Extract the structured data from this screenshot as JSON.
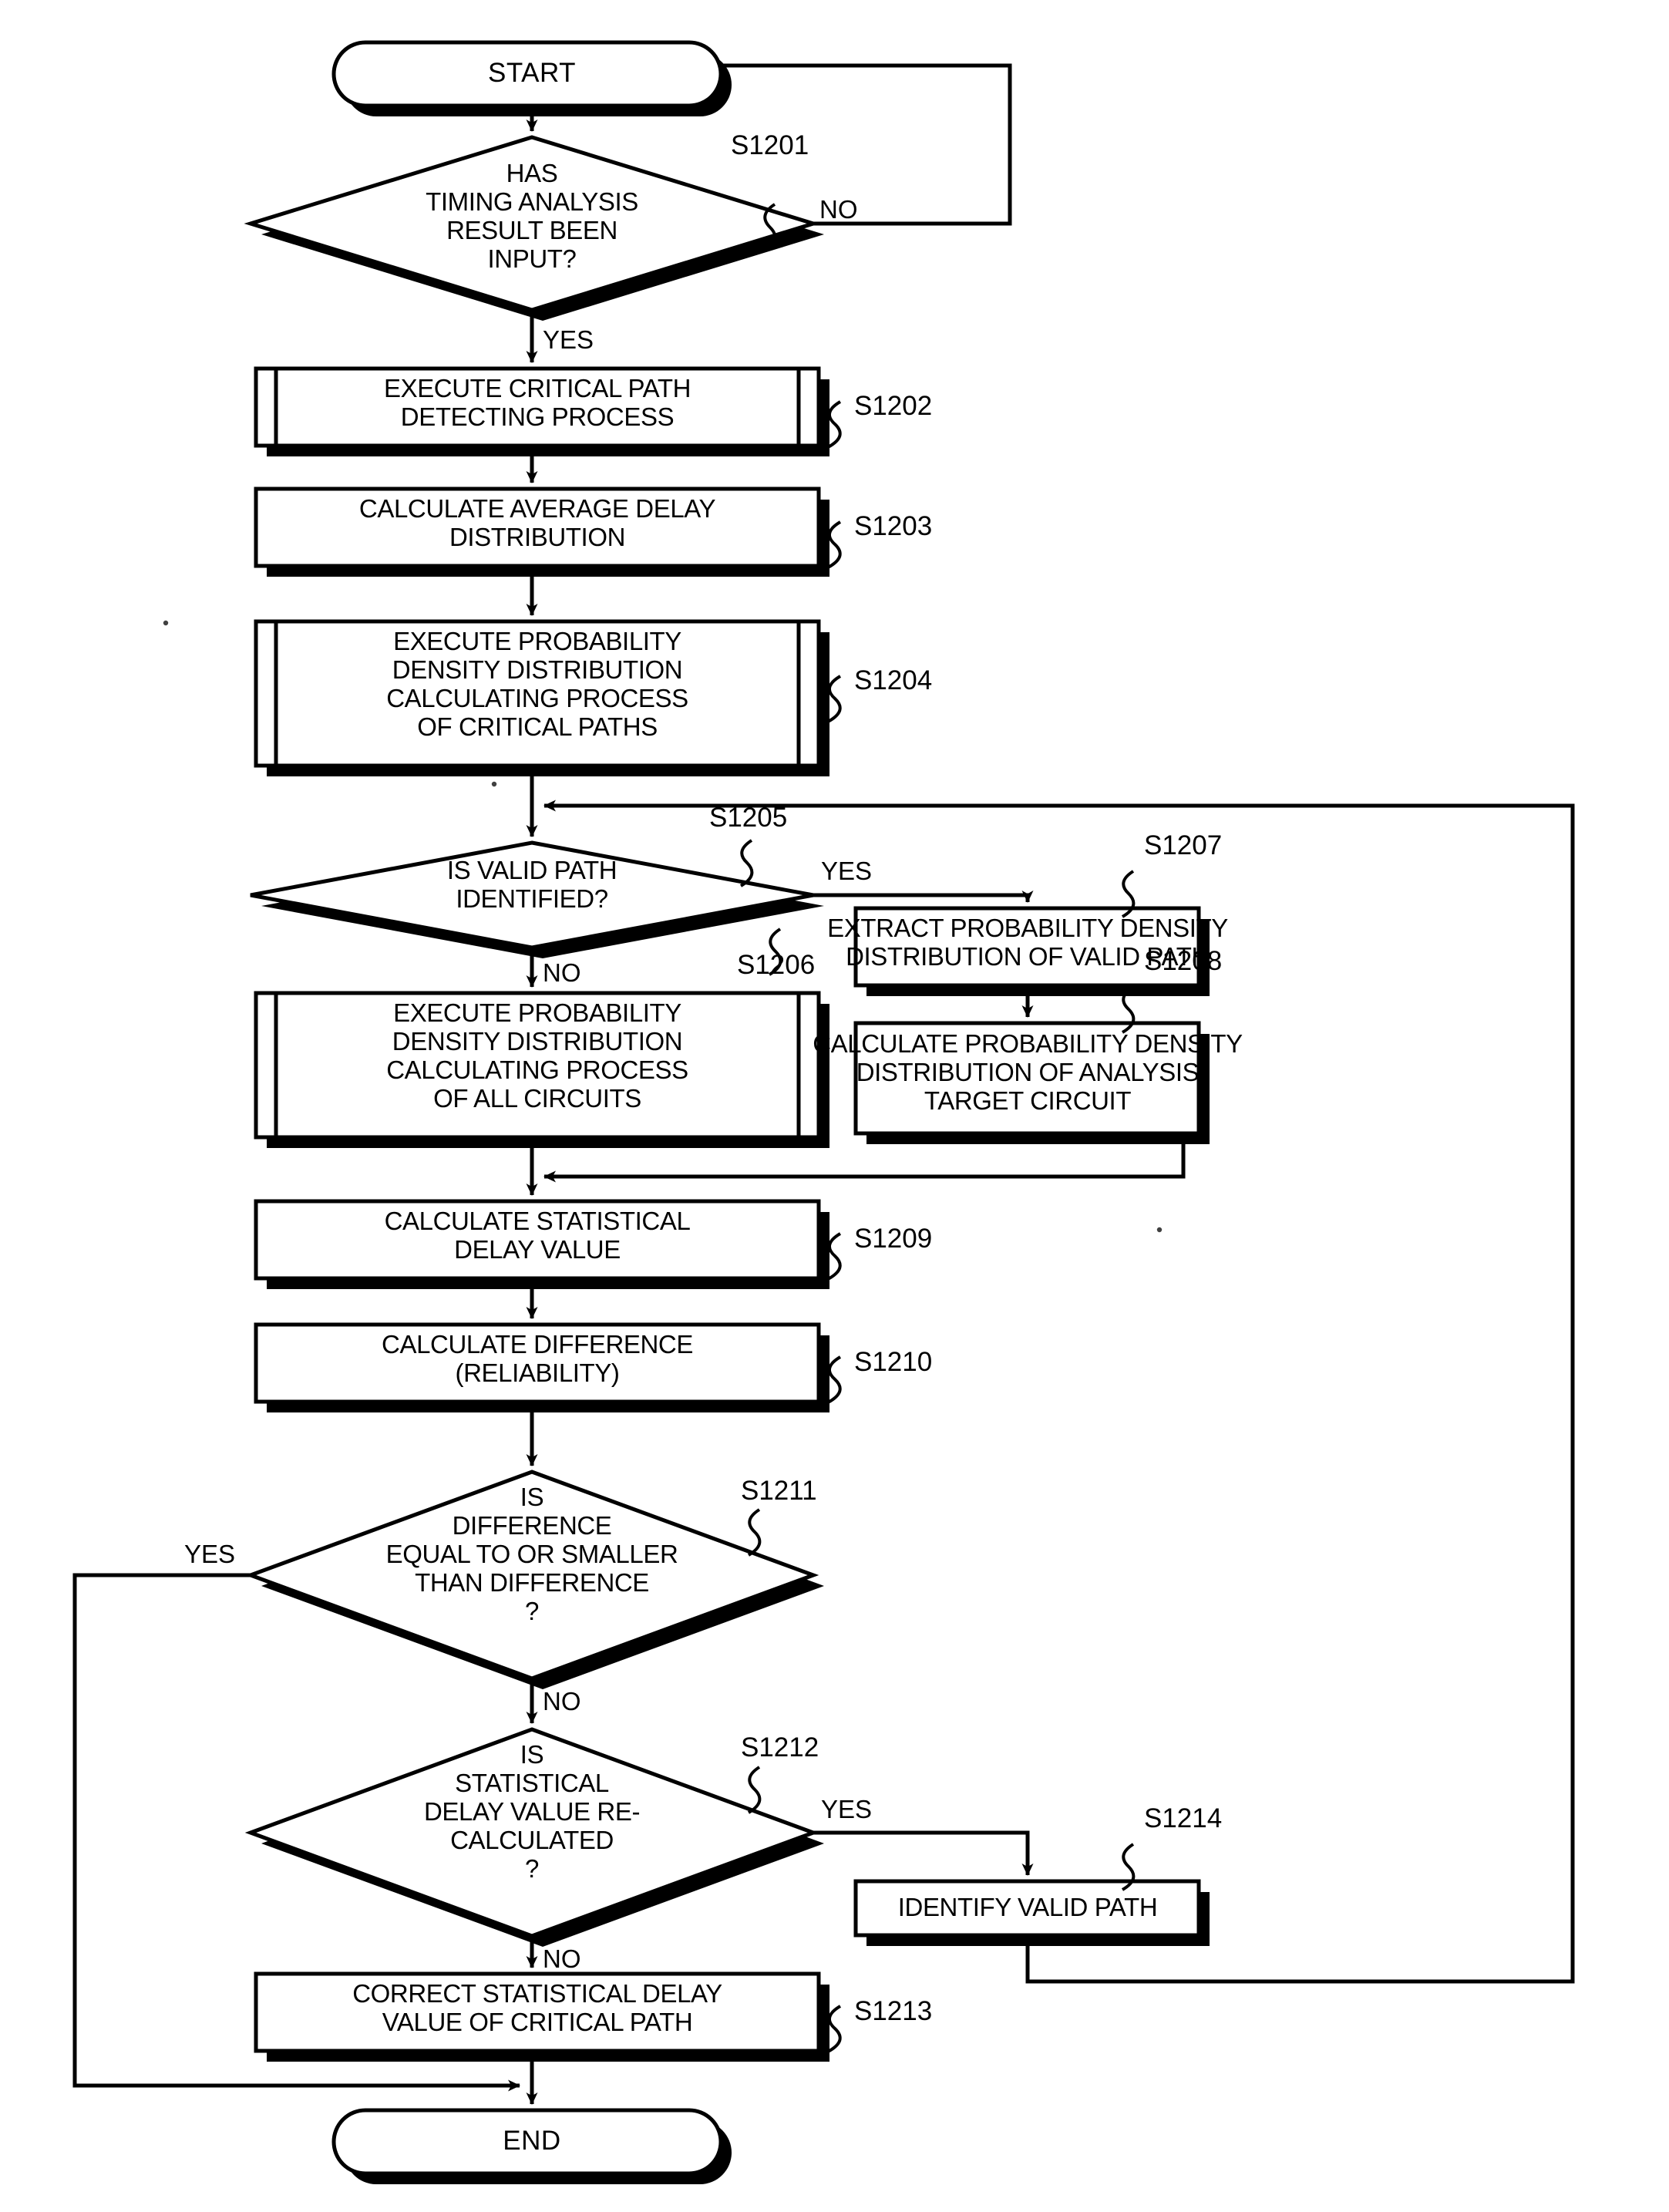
{
  "diagram": {
    "type": "flowchart",
    "title_text": "",
    "colors": {
      "stroke": "#000000",
      "fill": "#ffffff",
      "shadow": "#000000"
    },
    "terminators": [
      {
        "id": "start",
        "label": "START"
      },
      {
        "id": "end",
        "label": "END"
      }
    ],
    "decisions": [
      {
        "id": "d1201",
        "ref": "S1201",
        "lines": [
          "HAS",
          "TIMING ANALYSIS",
          "RESULT BEEN",
          "INPUT?"
        ],
        "yes": "YES",
        "no": "NO"
      },
      {
        "id": "d1205",
        "ref": "S1205",
        "lines": [
          "IS VALID PATH",
          "IDENTIFIED?"
        ],
        "yes": "YES",
        "no": "NO"
      },
      {
        "id": "d1211",
        "ref": "S1211",
        "lines": [
          "IS",
          "DIFFERENCE",
          "EQUAL TO OR SMALLER",
          "THAN DIFFERENCE",
          "?"
        ],
        "yes": "YES",
        "no": "NO"
      },
      {
        "id": "d1212",
        "ref": "S1212",
        "lines": [
          "IS",
          "STATISTICAL",
          "DELAY VALUE RE-",
          "CALCULATED",
          "?"
        ],
        "yes": "YES",
        "no": "NO"
      }
    ],
    "processes": [
      {
        "id": "p1202",
        "ref": "S1202",
        "kind": "predefined",
        "lines": [
          "EXECUTE CRITICAL PATH",
          "DETECTING PROCESS"
        ]
      },
      {
        "id": "p1203",
        "ref": "S1203",
        "kind": "process",
        "lines": [
          "CALCULATE AVERAGE DELAY",
          "DISTRIBUTION"
        ]
      },
      {
        "id": "p1204",
        "ref": "S1204",
        "kind": "predefined",
        "lines": [
          "EXECUTE PROBABILITY",
          "DENSITY DISTRIBUTION",
          "CALCULATING PROCESS",
          "OF CRITICAL PATHS"
        ]
      },
      {
        "id": "p1206",
        "ref": "S1206",
        "kind": "predefined",
        "lines": [
          "EXECUTE PROBABILITY",
          "DENSITY DISTRIBUTION",
          "CALCULATING PROCESS",
          "OF ALL CIRCUITS"
        ]
      },
      {
        "id": "p1207",
        "ref": "S1207",
        "kind": "process",
        "lines": [
          "EXTRACT PROBABILITY DENSITY",
          "DISTRIBUTION OF VALID PATH"
        ]
      },
      {
        "id": "p1208",
        "ref": "S1208",
        "kind": "process",
        "lines": [
          "CALCULATE PROBABILITY DENSITY",
          "DISTRIBUTION OF ANALYSIS",
          "TARGET CIRCUIT"
        ]
      },
      {
        "id": "p1209",
        "ref": "S1209",
        "kind": "process",
        "lines": [
          "CALCULATE STATISTICAL",
          "DELAY VALUE"
        ]
      },
      {
        "id": "p1210",
        "ref": "S1210",
        "kind": "process",
        "lines": [
          "CALCULATE DIFFERENCE",
          "(RELIABILITY)"
        ]
      },
      {
        "id": "p1213",
        "ref": "S1213",
        "kind": "process",
        "lines": [
          "CORRECT STATISTICAL DELAY",
          "VALUE OF CRITICAL PATH"
        ]
      },
      {
        "id": "p1214",
        "ref": "S1214",
        "kind": "process",
        "lines": [
          "IDENTIFY VALID PATH"
        ]
      }
    ]
  },
  "text": {
    "start": "START",
    "end": "END",
    "d1201_l1": "HAS",
    "d1201_l2": "TIMING ANALYSIS",
    "d1201_l3": "RESULT BEEN",
    "d1201_l4": "INPUT?",
    "d1201_ref": "S1201",
    "d1201_no": "NO",
    "d1201_yes": "YES",
    "p1202_l1": "EXECUTE CRITICAL PATH",
    "p1202_l2": "DETECTING PROCESS",
    "p1202_ref": "S1202",
    "p1203_l1": "CALCULATE AVERAGE DELAY",
    "p1203_l2": "DISTRIBUTION",
    "p1203_ref": "S1203",
    "p1204_l1": "EXECUTE PROBABILITY",
    "p1204_l2": "DENSITY DISTRIBUTION",
    "p1204_l3": "CALCULATING PROCESS",
    "p1204_l4": "OF CRITICAL PATHS",
    "p1204_ref": "S1204",
    "d1205_l1": "IS VALID PATH",
    "d1205_l2": "IDENTIFIED?",
    "d1205_ref": "S1205",
    "d1205_yes": "YES",
    "d1205_no": "NO",
    "p1206_l1": "EXECUTE PROBABILITY",
    "p1206_l2": "DENSITY DISTRIBUTION",
    "p1206_l3": "CALCULATING PROCESS",
    "p1206_l4": "OF ALL CIRCUITS",
    "p1206_ref": "S1206",
    "p1207_l1": "EXTRACT PROBABILITY DENSITY",
    "p1207_l2": "DISTRIBUTION OF VALID PATH",
    "p1207_ref": "S1207",
    "p1208_l1": "CALCULATE PROBABILITY DENSITY",
    "p1208_l2": "DISTRIBUTION OF ANALYSIS",
    "p1208_l3": "TARGET CIRCUIT",
    "p1208_ref": "S1208",
    "p1209_l1": "CALCULATE STATISTICAL",
    "p1209_l2": "DELAY VALUE",
    "p1209_ref": "S1209",
    "p1210_l1": "CALCULATE DIFFERENCE",
    "p1210_l2": "(RELIABILITY)",
    "p1210_ref": "S1210",
    "d1211_l1": "IS",
    "d1211_l2": "DIFFERENCE",
    "d1211_l3": "EQUAL TO OR SMALLER",
    "d1211_l4": "THAN DIFFERENCE",
    "d1211_l5": "?",
    "d1211_ref": "S1211",
    "d1211_yes": "YES",
    "d1211_no": "NO",
    "d1212_l1": "IS",
    "d1212_l2": "STATISTICAL",
    "d1212_l3": "DELAY VALUE RE-",
    "d1212_l4": "CALCULATED",
    "d1212_l5": "?",
    "d1212_ref": "S1212",
    "d1212_yes": "YES",
    "d1212_no": "NO",
    "p1213_l1": "CORRECT STATISTICAL DELAY",
    "p1213_l2": "VALUE OF CRITICAL PATH",
    "p1213_ref": "S1213",
    "p1214_l1": "IDENTIFY VALID PATH",
    "p1214_ref": "S1214"
  }
}
